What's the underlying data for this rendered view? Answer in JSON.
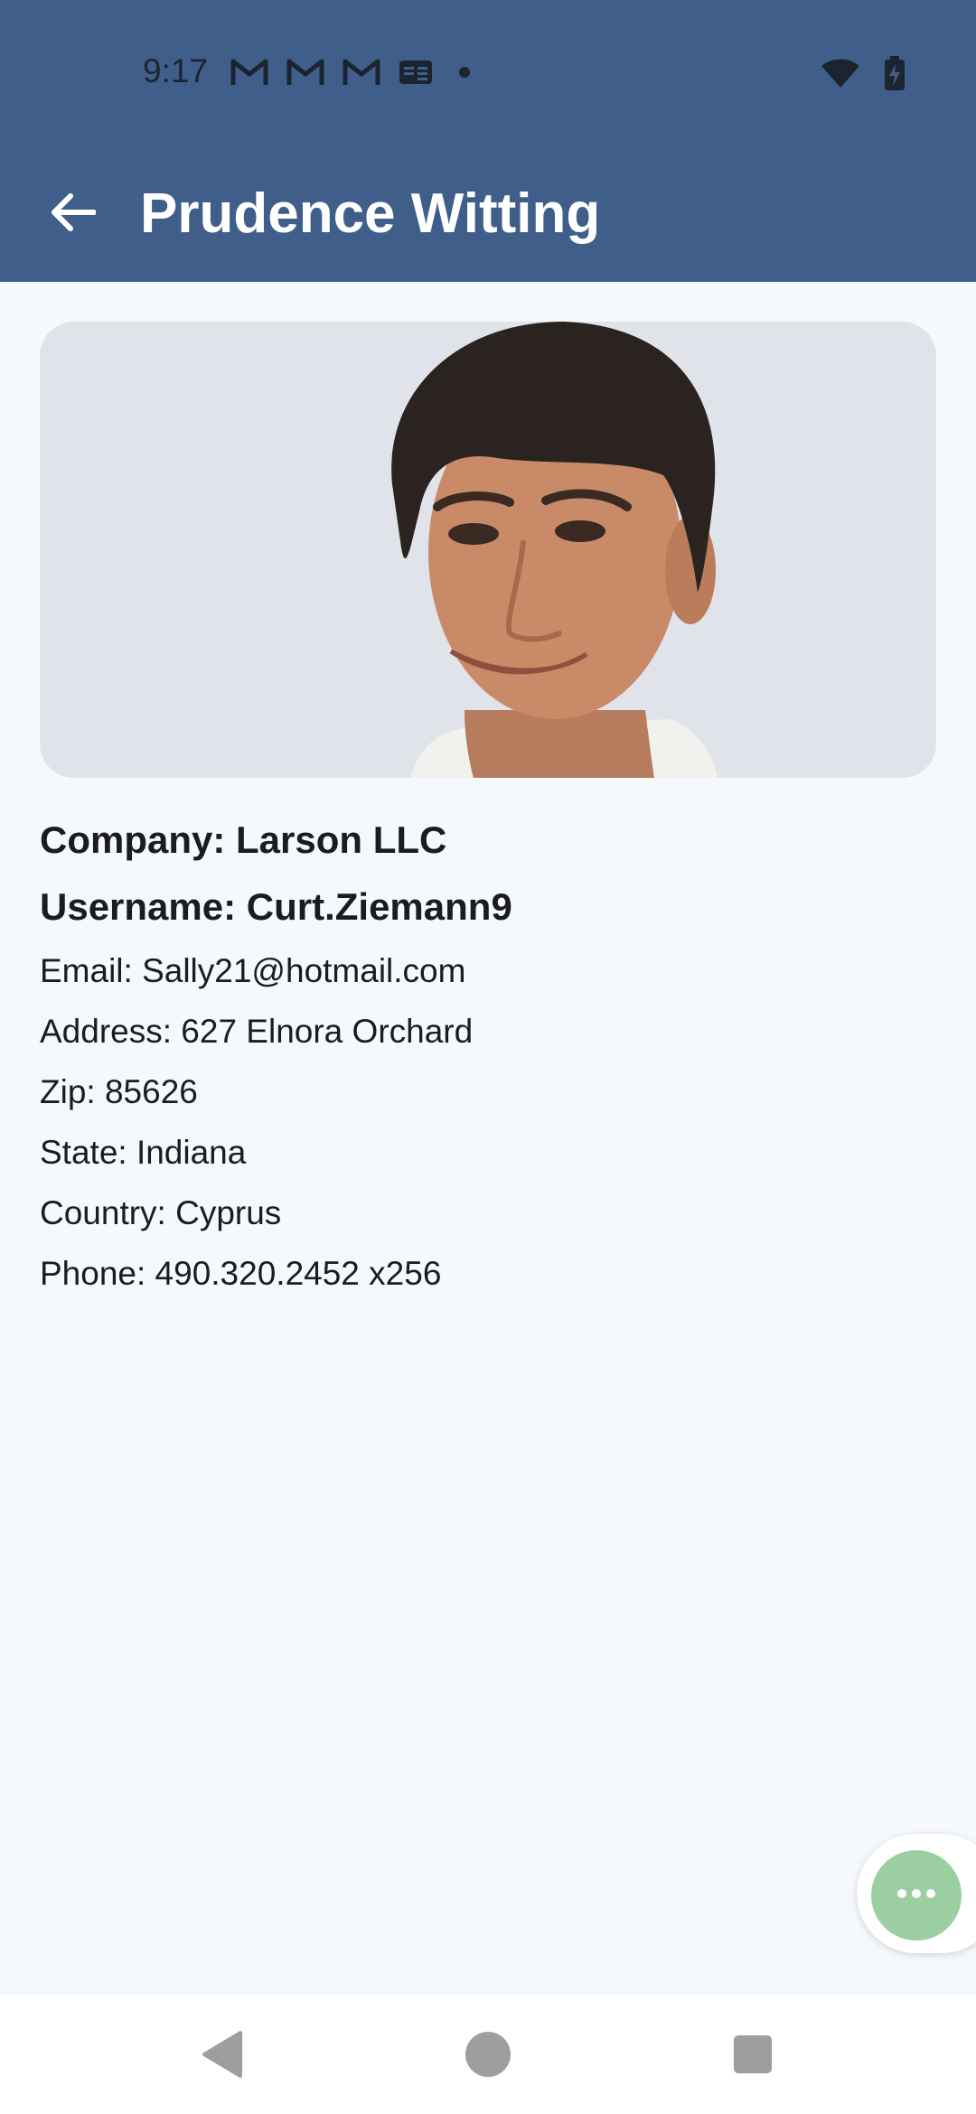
{
  "status_bar": {
    "time": "9:17",
    "notification_icons": [
      "gmail-icon",
      "gmail-icon",
      "gmail-icon",
      "news-icon",
      "dot-icon"
    ],
    "system_icons": [
      "wifi-icon",
      "battery-charging-icon"
    ]
  },
  "app_bar": {
    "title": "Prudence Witting",
    "back_icon": "arrow-back-icon"
  },
  "profile": {
    "company": "Company: Larson LLC",
    "username": "Username: Curt.Ziemann9",
    "email": "Email: Sally21@hotmail.com",
    "address": "Address: 627 Elnora Orchard",
    "zip": "Zip: 85626",
    "state": "State: Indiana",
    "country": "Country: Cyprus",
    "phone": "Phone: 490.320.2452 x256"
  },
  "fab": {
    "icon": "more-horizontal-icon"
  },
  "nav_bar": {
    "items": [
      "back-triangle-icon",
      "home-circle-icon",
      "recents-square-icon"
    ]
  },
  "colors": {
    "app_bar": "#3f5f8a",
    "background": "#f5f8fd",
    "fab": "#9bcfa2",
    "image_background": "#e1e3ea"
  }
}
